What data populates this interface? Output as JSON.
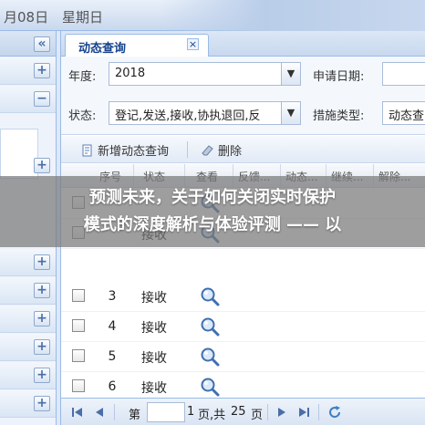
{
  "topbar": {
    "date": "月08日",
    "weekday": "星期日"
  },
  "tab": {
    "label": "动态查询",
    "close": "×"
  },
  "form": {
    "year_label": "年度:",
    "year_value": "2018",
    "apply_date_label": "申请日期:",
    "status_label": "状态:",
    "status_value": "登记,发送,接收,协执退回,反",
    "measure_type_label": "措施类型:",
    "measure_type_value": "动态查",
    "dropdown_glyph": "▼"
  },
  "toolbar": {
    "add_label": "新增动态查询",
    "delete_label": "删除"
  },
  "grid": {
    "headers": [
      "序号",
      "状态",
      "查看",
      "反馈...",
      "动态...",
      "继续...",
      "解除..."
    ],
    "rows": [
      {
        "num": "",
        "status": ""
      },
      {
        "num": "",
        "status": "接收"
      },
      {
        "num": "3",
        "status": "接收"
      },
      {
        "num": "4",
        "status": "接收"
      },
      {
        "num": "5",
        "status": "接收"
      },
      {
        "num": "6",
        "status": "接收"
      }
    ]
  },
  "pager": {
    "page_label": "第",
    "page_value": "1",
    "of_text": "页,共",
    "total_pages": "25",
    "page_suffix": "页"
  },
  "banner": {
    "line1": "预测未来，关于如何关闭实时保护",
    "line2": "模式的深度解析与体验评测 —— 以"
  },
  "leftpanel": {
    "collapse_glyph": "«",
    "plus_glyph": "+",
    "minus_glyph": "−"
  },
  "colors": {
    "accent": "#15428b",
    "border": "#99bbe8",
    "banner": "#7a7a7a"
  }
}
